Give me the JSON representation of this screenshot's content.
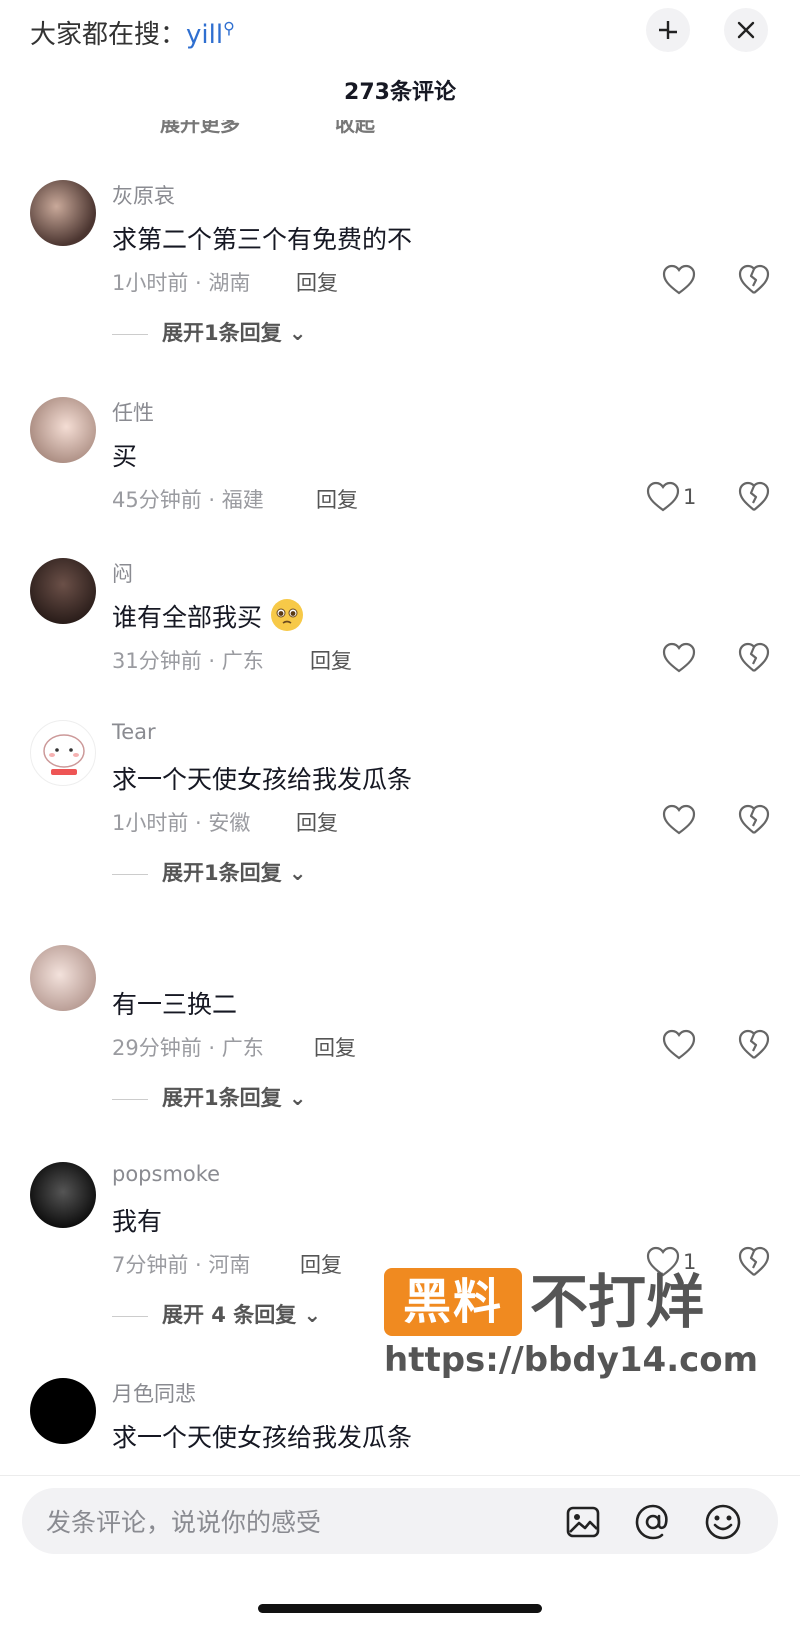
{
  "header": {
    "search_prefix": "大家都在搜：",
    "search_keyword": "yill",
    "comment_count": "273条评论"
  },
  "cut_row": {
    "left": "展开更多",
    "right": "收起"
  },
  "comments": [
    {
      "name": "灰原哀",
      "text": "求第二个第三个有免费的不",
      "time_location": "1小时前 · 湖南",
      "reply": "回复",
      "likes": "",
      "expand": "展开1条回复"
    },
    {
      "name": "任性",
      "text": "买",
      "time_location": "45分钟前 · 福建",
      "reply": "回复",
      "likes": "1",
      "expand": ""
    },
    {
      "name": "闷",
      "text": "谁有全部我买",
      "emoji": "pleading-face",
      "time_location": "31分钟前 · 广东",
      "reply": "回复",
      "likes": "",
      "expand": ""
    },
    {
      "name": "Tear",
      "text": "求一个天使女孩给我发瓜条",
      "time_location": "1小时前 · 安徽",
      "reply": "回复",
      "likes": "",
      "expand": "展开1条回复"
    },
    {
      "name": "",
      "text": "有一三换二",
      "time_location": "29分钟前 · 广东",
      "reply": "回复",
      "likes": "",
      "expand": "展开1条回复"
    },
    {
      "name": "popsmoke",
      "text": "我有",
      "time_location": "7分钟前 · 河南",
      "reply": "回复",
      "likes": "1",
      "expand": "展开 4 条回复"
    },
    {
      "name": "月色同悲",
      "text": "求一个天使女孩给我发瓜条",
      "time_location": "",
      "reply": "",
      "likes": "",
      "expand": ""
    }
  ],
  "watermark": {
    "badge": "黑料",
    "title": "不打烊",
    "url": "https://bbdy14.com"
  },
  "composer": {
    "placeholder": "发条评论，说说你的感受"
  },
  "icons": {
    "collapse": "collapse-icon",
    "close": "close-icon",
    "like": "heart-outline-icon",
    "dislike": "broken-heart-icon",
    "image": "image-icon",
    "mention": "at-sign-icon",
    "emoji": "emoji-icon"
  },
  "colors": {
    "keyword": "#2f6fd0",
    "watermark_badge": "#f08a20"
  }
}
